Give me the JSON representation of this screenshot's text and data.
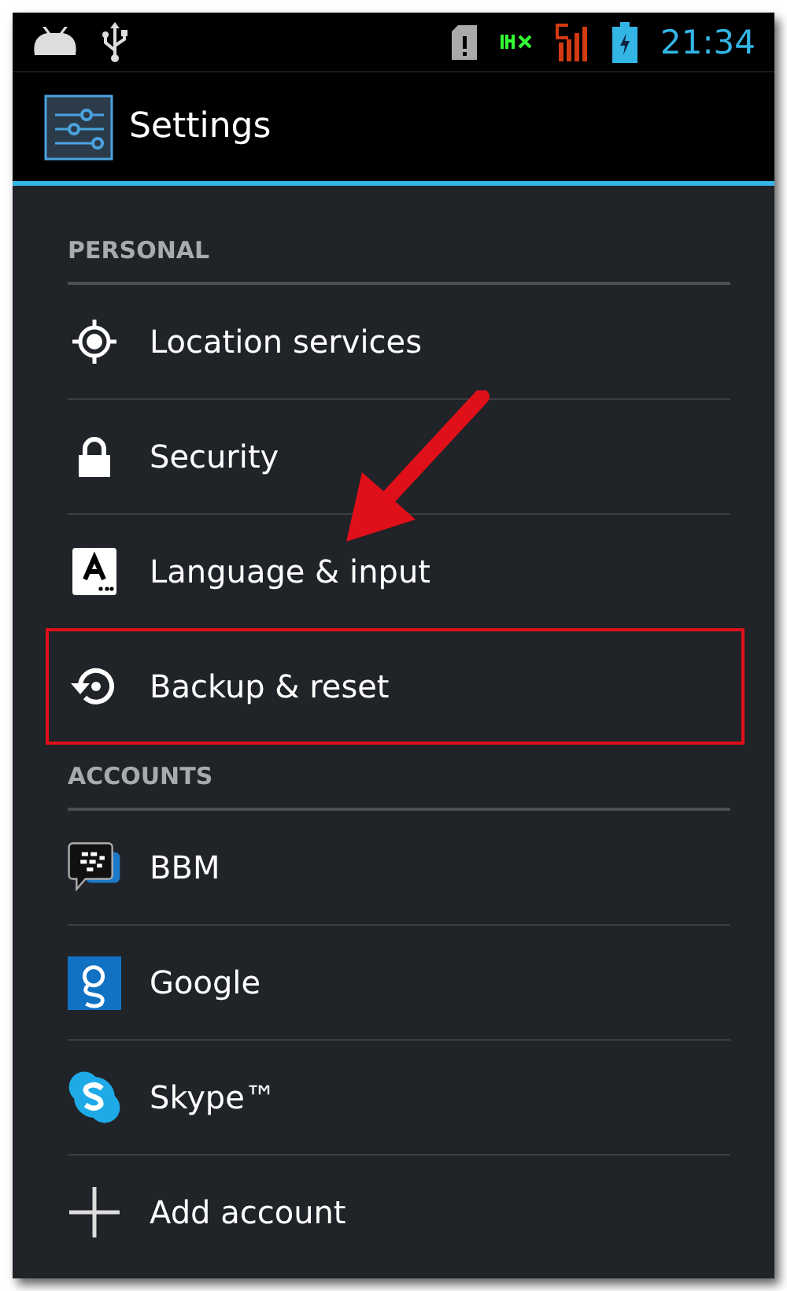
{
  "status_bar": {
    "time": "21:34"
  },
  "action_bar": {
    "title": "Settings"
  },
  "sections": [
    {
      "header": "PERSONAL",
      "items": [
        {
          "label": "Location services",
          "kind": "location",
          "highlighted": false
        },
        {
          "label": "Security",
          "kind": "lock",
          "highlighted": false
        },
        {
          "label": "Language & input",
          "kind": "language",
          "highlighted": false
        },
        {
          "label": "Backup & reset",
          "kind": "backup",
          "highlighted": true
        }
      ]
    },
    {
      "header": "ACCOUNTS",
      "items": [
        {
          "label": "BBM",
          "kind": "bbm",
          "highlighted": false
        },
        {
          "label": "Google",
          "kind": "google",
          "highlighted": false
        },
        {
          "label": "Skype™",
          "kind": "skype",
          "highlighted": false
        },
        {
          "label": "Add account",
          "kind": "add",
          "highlighted": false
        }
      ]
    }
  ]
}
